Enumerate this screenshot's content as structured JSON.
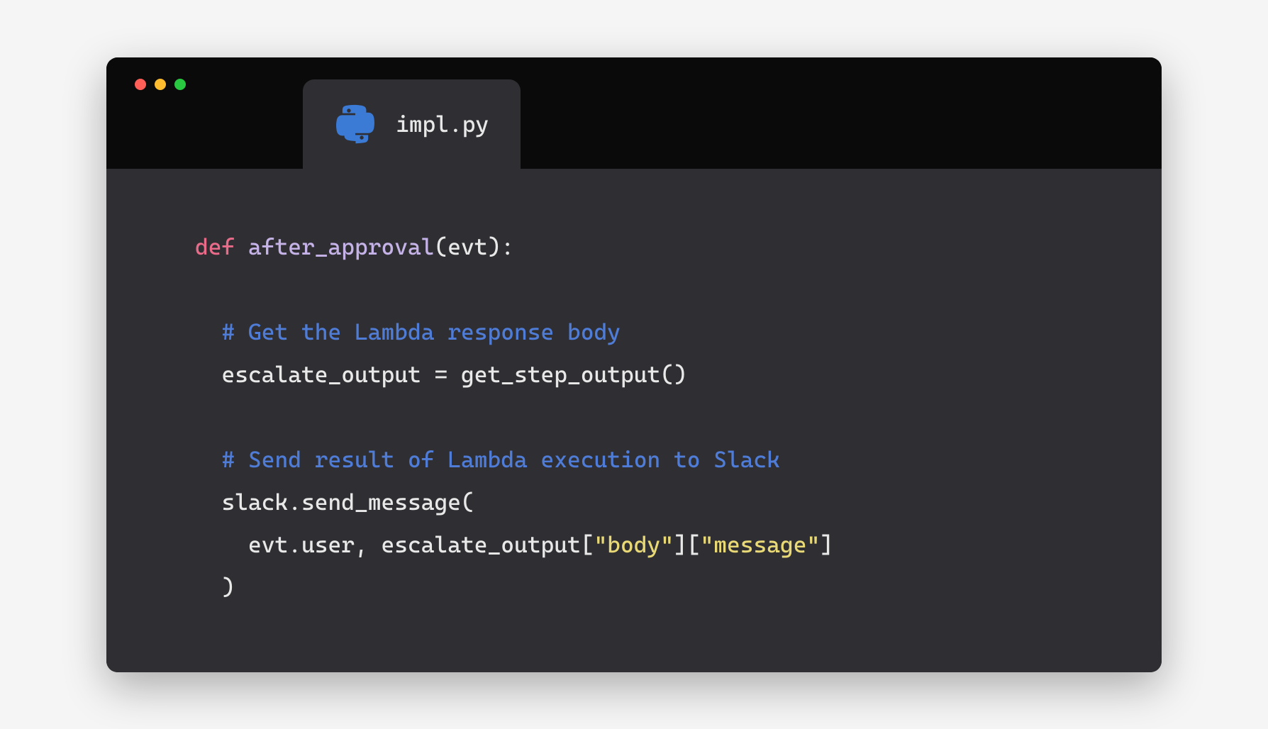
{
  "tab": {
    "filename": "impl.py",
    "language": "python"
  },
  "code": {
    "line1": {
      "keyword": "def ",
      "function": "after_approval",
      "rest": "(evt):"
    },
    "line2": "",
    "line3": {
      "indent": "  ",
      "comment": "# Get the Lambda response body"
    },
    "line4": {
      "indent": "  ",
      "text": "escalate_output = get_step_output()"
    },
    "line5": "",
    "line6": {
      "indent": "  ",
      "comment": "# Send result of Lambda execution to Slack"
    },
    "line7": {
      "indent": "  ",
      "text": "slack.send_message("
    },
    "line8": {
      "indent": "    ",
      "part1": "evt.user, escalate_output[",
      "str1": "\"body\"",
      "part2": "][",
      "str2": "\"message\"",
      "part3": "]"
    },
    "line9": {
      "indent": "  ",
      "text": ")"
    }
  }
}
